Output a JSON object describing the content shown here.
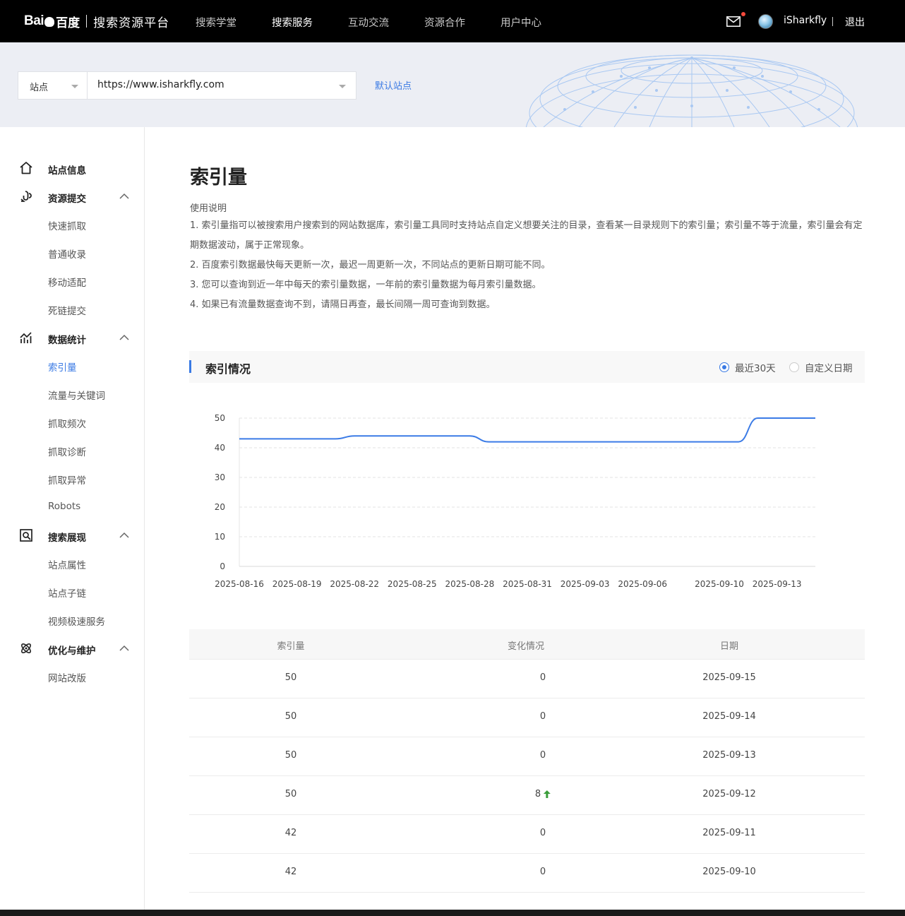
{
  "header": {
    "logo_text": "Bai",
    "logo_brand": "百度",
    "platform_title": "搜索资源平台",
    "nav": [
      {
        "label": "搜索学堂",
        "active": false
      },
      {
        "label": "搜索服务",
        "active": true
      },
      {
        "label": "互动交流",
        "active": false
      },
      {
        "label": "资源合作",
        "active": false
      },
      {
        "label": "用户中心",
        "active": false
      }
    ],
    "mail_icon": "mail-icon",
    "username": "iSharkfly",
    "separator": "|",
    "logout": "退出"
  },
  "site_bar": {
    "type_label": "站点",
    "url": "https://www.isharkfly.com",
    "default_site": "默认站点"
  },
  "sidebar": {
    "groups": [
      {
        "label": "站点信息",
        "icon": "home-icon",
        "items": []
      },
      {
        "label": "资源提交",
        "icon": "submit-link-icon",
        "items": [
          {
            "label": "快速抓取"
          },
          {
            "label": "普通收录"
          },
          {
            "label": "移动适配"
          },
          {
            "label": "死链提交"
          }
        ]
      },
      {
        "label": "数据统计",
        "icon": "stats-chart-icon",
        "items": [
          {
            "label": "索引量",
            "active": true
          },
          {
            "label": "流量与关键词"
          },
          {
            "label": "抓取频次"
          },
          {
            "label": "抓取诊断"
          },
          {
            "label": "抓取异常"
          },
          {
            "label": "Robots"
          }
        ]
      },
      {
        "label": "搜索展现",
        "icon": "search-display-icon",
        "items": [
          {
            "label": "站点属性"
          },
          {
            "label": "站点子链"
          },
          {
            "label": "视频极速服务"
          }
        ]
      },
      {
        "label": "优化与维护",
        "icon": "optimize-icon",
        "items": [
          {
            "label": "网站改版"
          }
        ]
      }
    ]
  },
  "main": {
    "title": "索引量",
    "usage_title": "使用说明",
    "usage_lines": [
      "1. 索引量指可以被搜索用户搜索到的网站数据库，索引量工具同时支持站点自定义想要关注的目录，查看某一目录规则下的索引量；索引量不等于流量，索引量会有定期数据波动，属于正常现象。",
      "2. 百度索引数据最快每天更新一次，最迟一周更新一次，不同站点的更新日期可能不同。",
      "3. 您可以查询到近一年中每天的索引量数据，一年前的索引量数据为每月索引量数据。",
      "4. 如果已有流量数据查询不到，请隔日再查，最长间隔一周可查询到数据。"
    ],
    "section_title": "索引情况",
    "radio_recent": "最近30天",
    "radio_custom": "自定义日期"
  },
  "chart_data": {
    "type": "line",
    "x": [
      "2025-08-16",
      "2025-08-17",
      "2025-08-18",
      "2025-08-19",
      "2025-08-20",
      "2025-08-21",
      "2025-08-22",
      "2025-08-23",
      "2025-08-24",
      "2025-08-25",
      "2025-08-26",
      "2025-08-27",
      "2025-08-28",
      "2025-08-29",
      "2025-08-30",
      "2025-08-31",
      "2025-09-01",
      "2025-09-02",
      "2025-09-03",
      "2025-09-04",
      "2025-09-05",
      "2025-09-06",
      "2025-09-07",
      "2025-09-08",
      "2025-09-09",
      "2025-09-10",
      "2025-09-11",
      "2025-09-12",
      "2025-09-13",
      "2025-09-14",
      "2025-09-15"
    ],
    "xticks": [
      "2025-08-16",
      "2025-08-19",
      "2025-08-22",
      "2025-08-25",
      "2025-08-28",
      "2025-08-31",
      "2025-09-03",
      "2025-09-06",
      "2025-09-10",
      "2025-09-13"
    ],
    "series": [
      {
        "values": [
          43,
          43,
          43,
          43,
          43,
          43,
          44,
          44,
          44,
          44,
          44,
          44,
          44,
          42,
          42,
          42,
          42,
          42,
          42,
          42,
          42,
          42,
          42,
          42,
          42,
          42,
          42,
          50,
          50,
          50,
          50
        ],
        "color": "#3b7be6"
      }
    ],
    "ylim": [
      0,
      50
    ],
    "yticks": [
      0,
      10,
      20,
      30,
      40,
      50
    ],
    "grid": true,
    "title": "",
    "xlabel": "",
    "ylabel": ""
  },
  "table": {
    "headers": [
      "索引量",
      "变化情况",
      "日期"
    ],
    "rows": [
      {
        "index": "50",
        "change": "0",
        "date": "2025-09-15",
        "up": false
      },
      {
        "index": "50",
        "change": "0",
        "date": "2025-09-14",
        "up": false
      },
      {
        "index": "50",
        "change": "0",
        "date": "2025-09-13",
        "up": false
      },
      {
        "index": "50",
        "change": "8",
        "date": "2025-09-12",
        "up": true
      },
      {
        "index": "42",
        "change": "0",
        "date": "2025-09-11",
        "up": false
      },
      {
        "index": "42",
        "change": "0",
        "date": "2025-09-10",
        "up": false
      }
    ],
    "up_color": "#3a9d3a"
  }
}
